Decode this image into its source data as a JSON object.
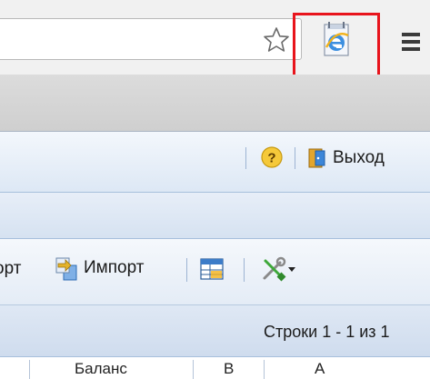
{
  "browser": {
    "bookmark_icon": "star-outline-icon",
    "extension_icon": "internet-explorer-icon",
    "menu_icon": "hamburger-menu-icon",
    "highlight_color": "#e8141c"
  },
  "app_header": {
    "help_icon": "help-question-icon",
    "exit_icon": "exit-door-icon",
    "exit_label": "Выход"
  },
  "grid_toolbar": {
    "export_label_partial": "орт",
    "import_label": "Импорт",
    "import_icon": "import-icon",
    "table_icon": "table-view-icon",
    "tools_icon": "tools-wrench-screwdriver-icon"
  },
  "status": {
    "rows_text": "Строки 1 - 1 из 1"
  },
  "columns": {
    "col1": "Баланс",
    "col2": "В",
    "col3": "А"
  }
}
